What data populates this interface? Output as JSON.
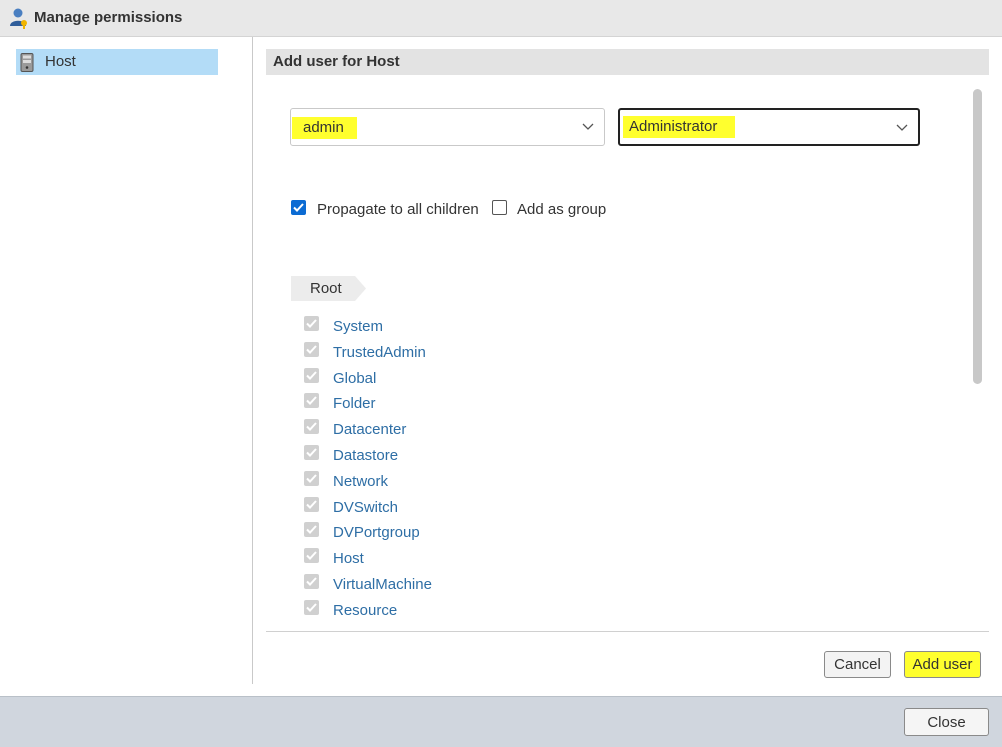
{
  "dialog": {
    "title": "Manage permissions",
    "icon": "user-key-icon"
  },
  "tree": {
    "items": [
      {
        "label": "Host",
        "icon": "host-icon",
        "selected": true
      }
    ]
  },
  "panel": {
    "header": "Add user for Host",
    "user_select": {
      "value": "admin"
    },
    "role_select": {
      "value": "Administrator"
    },
    "propagate": {
      "label": "Propagate to all children",
      "checked": true
    },
    "add_as_group": {
      "label": "Add as group",
      "checked": false
    },
    "breadcrumb": "Root",
    "privileges": [
      "System",
      "TrustedAdmin",
      "Global",
      "Folder",
      "Datacenter",
      "Datastore",
      "Network",
      "DVSwitch",
      "DVPortgroup",
      "Host",
      "VirtualMachine",
      "Resource"
    ],
    "cancel_label": "Cancel",
    "add_user_label": "Add user"
  },
  "footer": {
    "close_label": "Close"
  },
  "colors": {
    "highlight": "#ffff2e",
    "selected_tree": "#b3dcf7",
    "link": "#2e6ea5",
    "checkbox_checked": "#0b6bd3"
  }
}
